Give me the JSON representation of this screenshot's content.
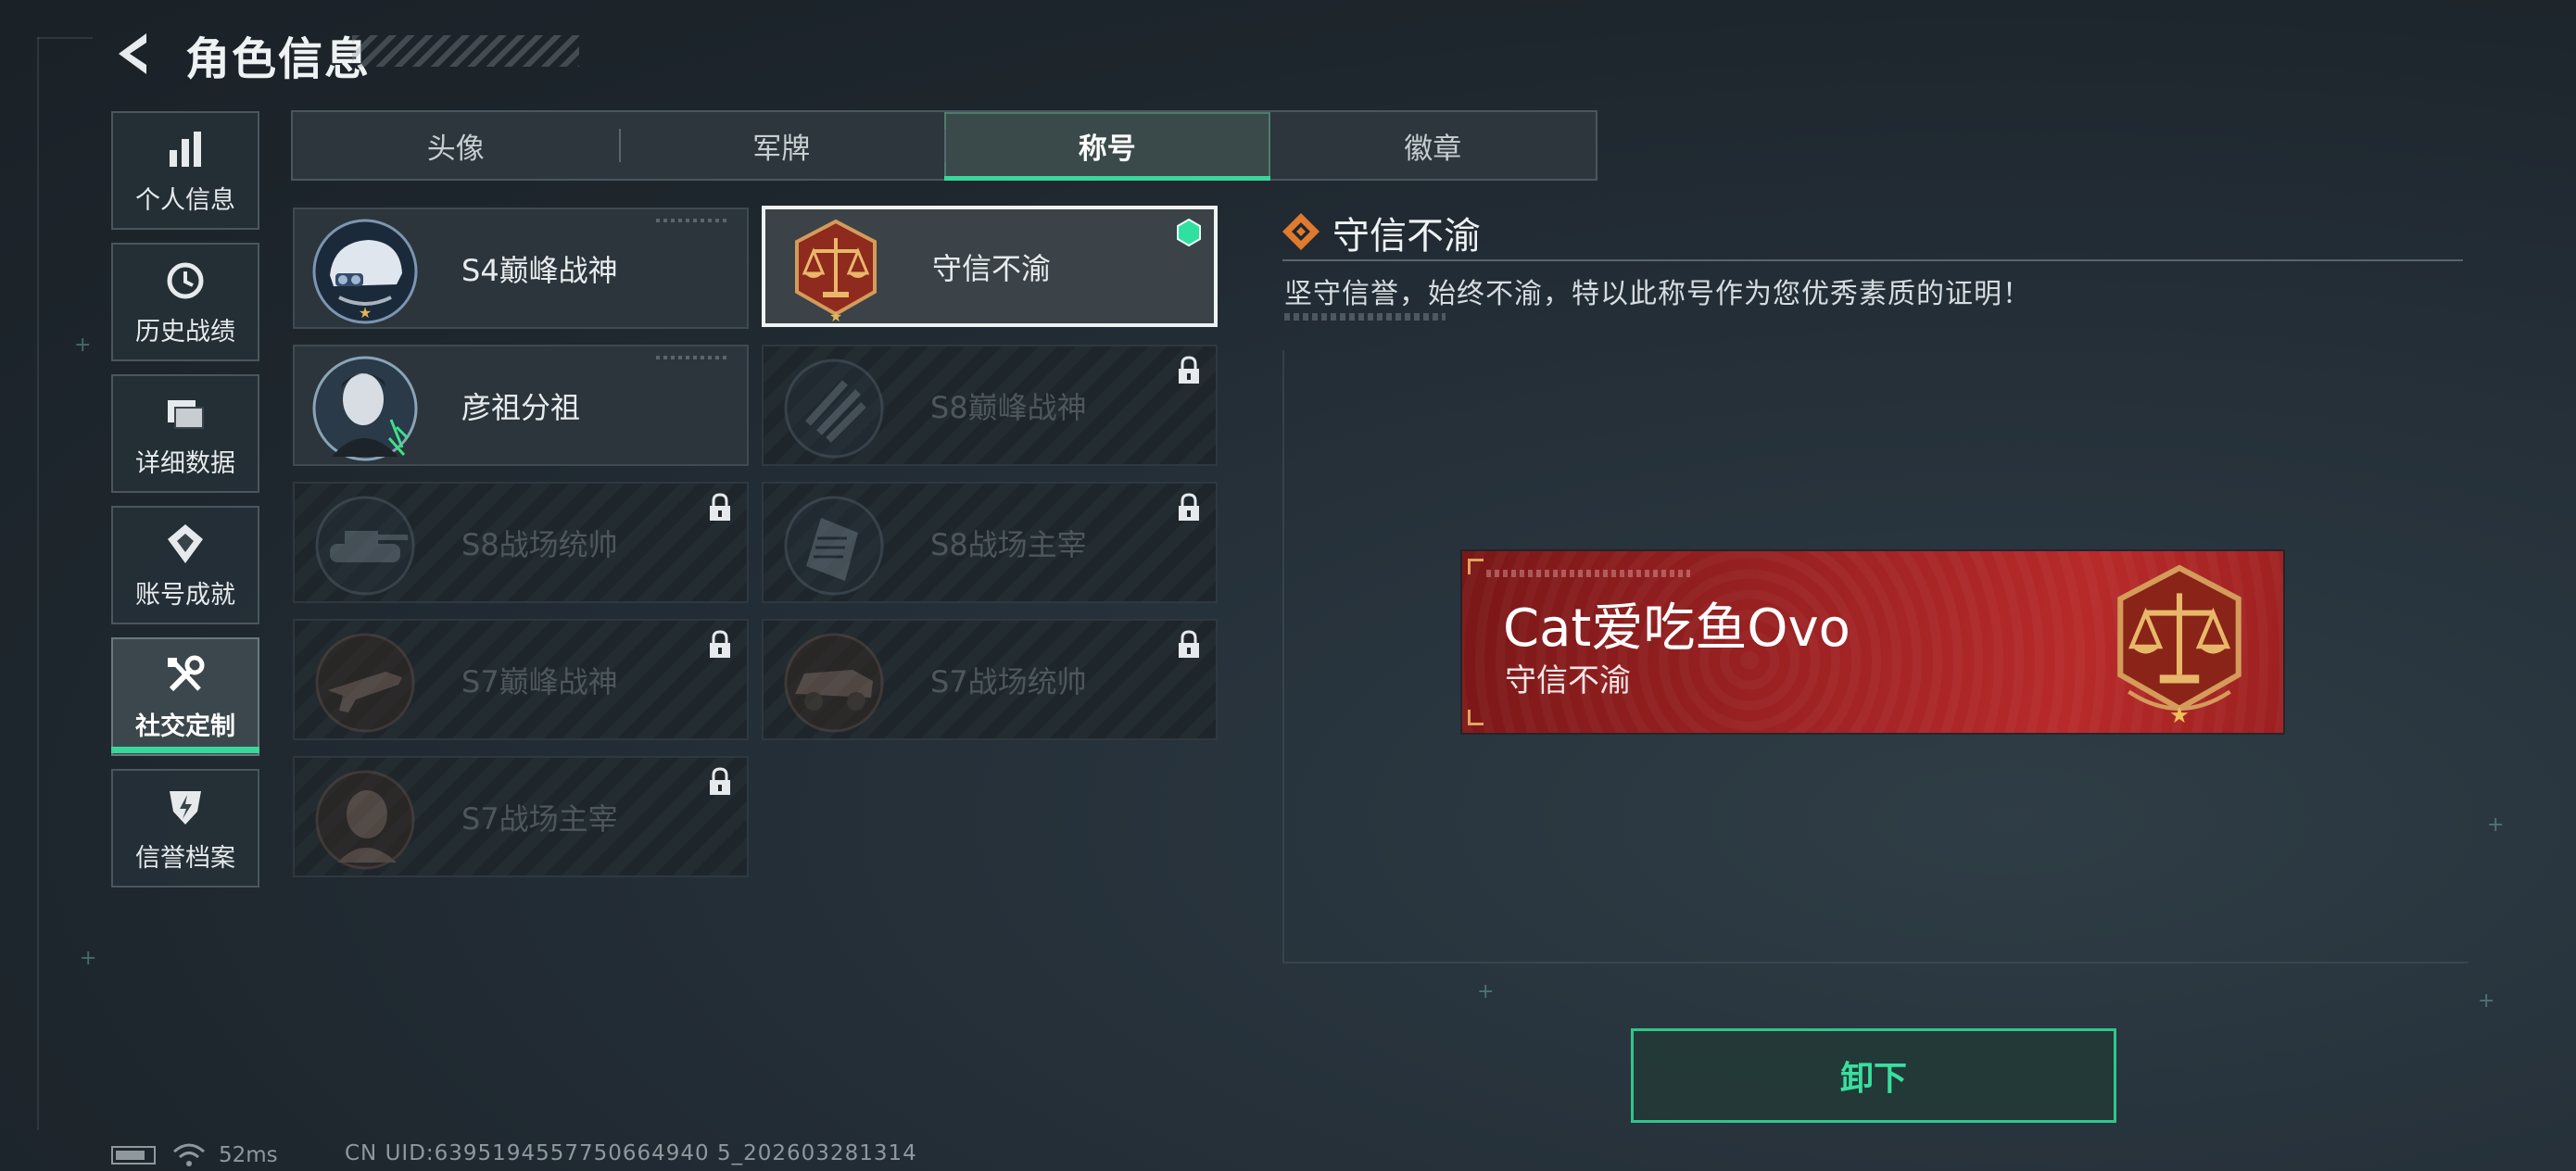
{
  "header": {
    "title": "角色信息",
    "back_icon": "chevron-left-icon"
  },
  "sidebar": {
    "items": [
      {
        "label": "个人信息",
        "icon": "bar-chart-icon",
        "active": false
      },
      {
        "label": "历史战绩",
        "icon": "history-clock-icon",
        "active": false
      },
      {
        "label": "详细数据",
        "icon": "folder-icon",
        "active": false
      },
      {
        "label": "账号成就",
        "icon": "achievement-badge-icon",
        "active": false
      },
      {
        "label": "社交定制",
        "icon": "tools-icon",
        "active": true
      },
      {
        "label": "信誉档案",
        "icon": "shield-bolt-icon",
        "active": false
      }
    ]
  },
  "tabs": [
    {
      "label": "头像",
      "active": false
    },
    {
      "label": "军牌",
      "active": false
    },
    {
      "label": "称号",
      "active": true
    },
    {
      "label": "徽章",
      "active": false
    }
  ],
  "titles": [
    {
      "name": "S4巅峰战神",
      "locked": false,
      "selected": false,
      "equipped": false,
      "emblem": "helmet-emblem-icon"
    },
    {
      "name": "守信不渝",
      "locked": false,
      "selected": true,
      "equipped": true,
      "emblem": "scales-emblem-icon"
    },
    {
      "name": "彦祖分祖",
      "locked": false,
      "selected": false,
      "equipped": false,
      "emblem": "portrait-emblem-icon"
    },
    {
      "name": "S8巅峰战神",
      "locked": true,
      "selected": false,
      "equipped": false,
      "emblem": "stripes-emblem-icon"
    },
    {
      "name": "S8战场统帅",
      "locked": true,
      "selected": false,
      "equipped": false,
      "emblem": "tank-emblem-icon"
    },
    {
      "name": "S8战场主宰",
      "locked": true,
      "selected": false,
      "equipped": false,
      "emblem": "building-emblem-icon"
    },
    {
      "name": "S7巅峰战神",
      "locked": true,
      "selected": false,
      "equipped": false,
      "emblem": "rifle-emblem-icon"
    },
    {
      "name": "S7战场统帅",
      "locked": true,
      "selected": false,
      "equipped": false,
      "emblem": "vehicle-emblem-icon"
    },
    {
      "name": "S7战场主宰",
      "locked": true,
      "selected": false,
      "equipped": false,
      "emblem": "soldier-emblem-icon"
    }
  ],
  "detail": {
    "title": "守信不渝",
    "description": "坚守信誉，始终不渝，特以此称号作为您优秀素质的证明！",
    "icon": "diamond-pattern-icon"
  },
  "preview": {
    "player_name": "Cat爱吃鱼Ovo",
    "title": "守信不渝",
    "emblem": "scales-emblem-icon"
  },
  "actions": {
    "unequip_label": "卸下"
  },
  "status": {
    "ping": "52ms",
    "uid": "CN UID:6395194557750664940 5_202603281314"
  },
  "colors": {
    "accent": "#38d79a",
    "banner_red": "#a02324",
    "background": "#1e262d"
  }
}
